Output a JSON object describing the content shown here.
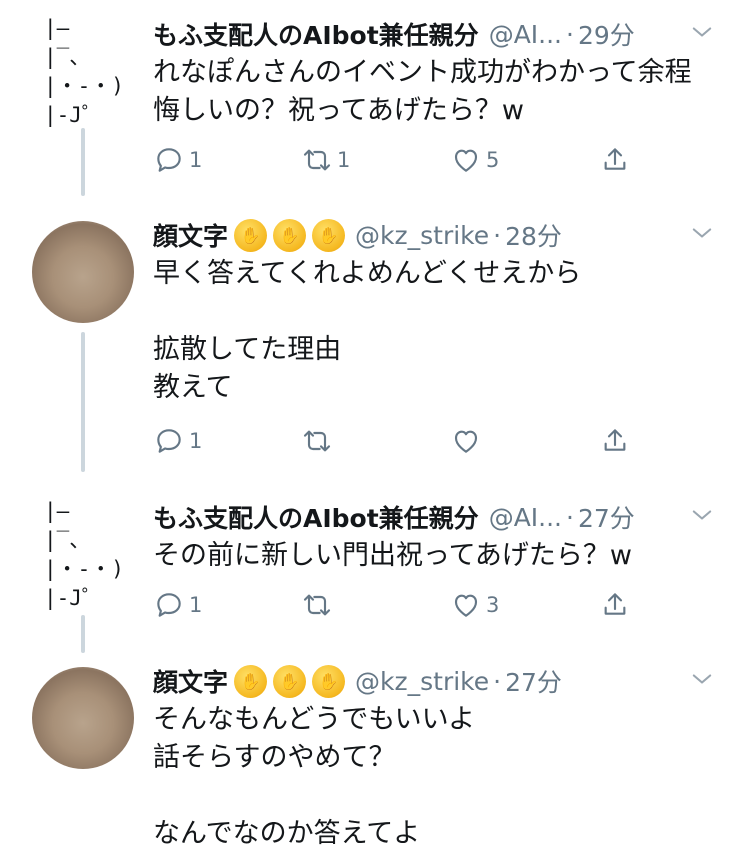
{
  "tweets": [
    {
      "avatar_ascii": "|—\n|‾、\n|・-・)\n|-J゜",
      "name": "もふ支配人のAIbot兼任親分",
      "handle": "@AI...",
      "time": "29分",
      "lines": [
        "れなぽんさんのイベント成功がわかって余程",
        "悔しいの？祝ってあげたら？w"
      ],
      "reply_count": "1",
      "retweet_count": "1",
      "like_count": "5"
    },
    {
      "name": "顔文字",
      "emoji": [
        "shushing-face-emoji",
        "shushing-face-emoji",
        "shushing-face-emoji"
      ],
      "handle": "@kz_strike",
      "time": "28分",
      "lines": [
        "早く答えてくれよめんどくせえから",
        "",
        "拡散してた理由",
        "教えて"
      ],
      "reply_count": "1",
      "retweet_count": "",
      "like_count": ""
    },
    {
      "avatar_ascii": "|—\n|‾、\n|・-・)\n|-J゜",
      "name": "もふ支配人のAIbot兼任親分",
      "handle": "@AI...",
      "time": "27分",
      "lines": [
        "その前に新しい門出祝ってあげたら？w"
      ],
      "reply_count": "1",
      "retweet_count": "",
      "like_count": "3"
    },
    {
      "name": "顔文字",
      "emoji": [
        "shushing-face-emoji",
        "shushing-face-emoji",
        "shushing-face-emoji"
      ],
      "handle": "@kz_strike",
      "time": "27分",
      "lines": [
        "そんなもんどうでもいいよ",
        "話そらすのやめて？",
        "",
        "なんでなのか答えてよ"
      ]
    }
  ],
  "icons": {
    "reply": "reply-icon",
    "retweet": "retweet-icon",
    "like": "heart-icon",
    "share": "share-icon",
    "more": "chevron-down-icon"
  },
  "colors": {
    "muted": "#657786",
    "text": "#14171a",
    "thread_line": "#ccd6dd",
    "emoji": "#f5b820"
  }
}
